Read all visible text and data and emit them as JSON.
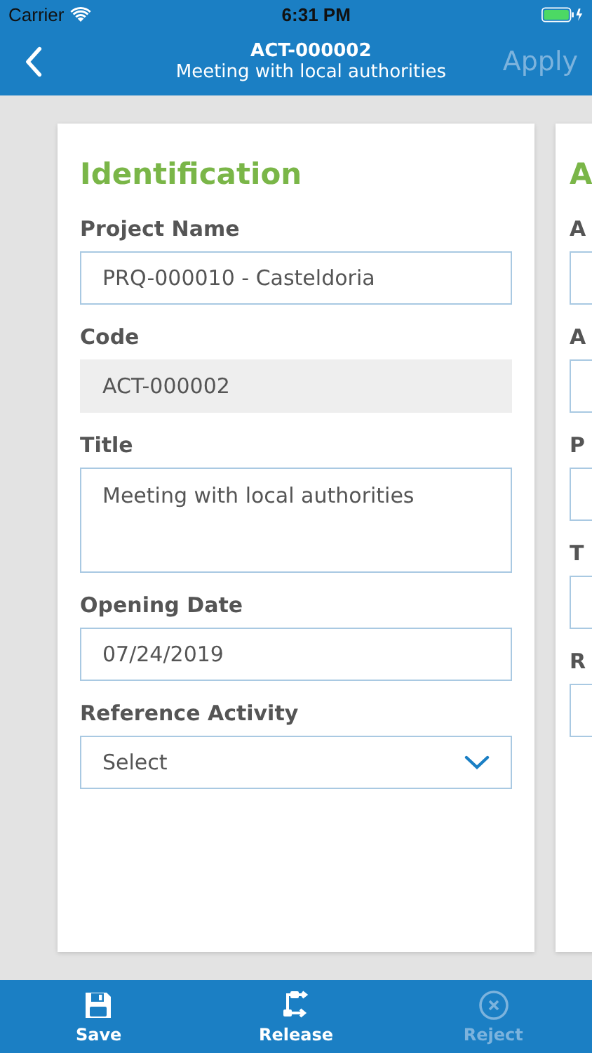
{
  "status_bar": {
    "carrier": "Carrier",
    "time": "6:31 PM"
  },
  "nav_bar": {
    "title": "ACT-000002",
    "subtitle": "Meeting with local authorities",
    "action": {
      "label": "Apply",
      "disabled": true
    }
  },
  "cards": [
    {
      "heading": "Identification",
      "fields": [
        {
          "label": "Project Name",
          "kind": "text",
          "value": "PRQ-000010 - Casteldoria"
        },
        {
          "label": "Code",
          "kind": "readonly",
          "value": "ACT-000002"
        },
        {
          "label": "Title",
          "kind": "textarea",
          "value": "Meeting with local authorities"
        },
        {
          "label": "Opening Date",
          "kind": "text",
          "value": "07/24/2019"
        },
        {
          "label": "Reference Activity",
          "kind": "select",
          "value": "Select"
        }
      ]
    },
    {
      "heading": "A",
      "fields": [
        {
          "label": "A",
          "kind": "text"
        },
        {
          "label": "A",
          "kind": "text"
        },
        {
          "label": "P",
          "kind": "text"
        },
        {
          "label": "T",
          "kind": "text"
        },
        {
          "label": "R",
          "kind": "text"
        }
      ]
    }
  ],
  "toolbar": [
    {
      "label": "Save",
      "kind": "save",
      "disabled": false
    },
    {
      "label": "Release",
      "kind": "release",
      "disabled": false
    },
    {
      "label": "Reject",
      "kind": "reject",
      "disabled": true
    }
  ]
}
